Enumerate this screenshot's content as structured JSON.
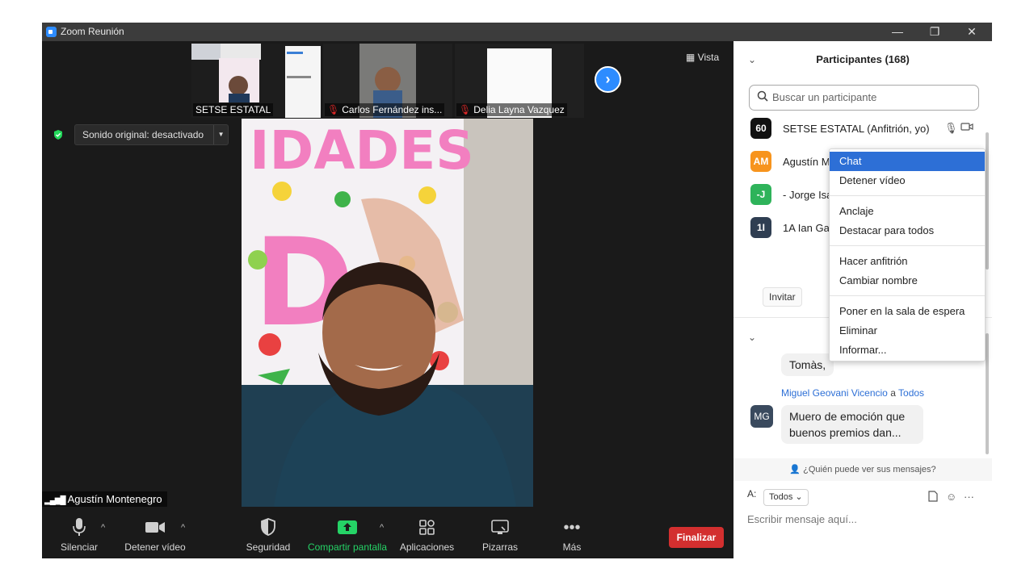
{
  "window": {
    "title": "Zoom Reunión",
    "minimize": "—",
    "restore": "❐",
    "close": "✕"
  },
  "gallery": {
    "thumbs": [
      {
        "label": "SETSE ESTATAL",
        "mic_off": false
      },
      {
        "label": "Carlos Fernández ins...",
        "mic_off": true
      },
      {
        "label": "Delia Layna Vazquez",
        "mic_off": true
      }
    ],
    "view_label": "Vista"
  },
  "meeting": {
    "sound_label": "Sonido original: desactivado",
    "speaker_name": "Agustín Montenegro"
  },
  "toolbar": {
    "mute": "Silenciar",
    "video": "Detener vídeo",
    "security": "Seguridad",
    "share": "Compartir pantalla",
    "apps": "Aplicaciones",
    "whiteboard": "Pizarras",
    "more": "Más",
    "end": "Finalizar"
  },
  "participants": {
    "title": "Participantes (168)",
    "search_placeholder": "Buscar un participante",
    "list": [
      {
        "initials": "60",
        "name": "SETSE ESTATAL (Anfitrión, yo)",
        "color": "#111111"
      },
      {
        "initials": "AM",
        "name": "Agustín M",
        "color": "#f7941d"
      },
      {
        "initials": "-J",
        "name": "- Jorge Isa",
        "color": "#2eb35a"
      },
      {
        "initials": "1I",
        "name": "1A Ian Gal",
        "color": "#2f3e52"
      }
    ],
    "invite": "Invitar"
  },
  "chat": {
    "partial_message": "Tomàs,",
    "sender": "Miguel Geovani Vicencio",
    "sender_to": "a",
    "recipient": "Todos",
    "sender_initials": "MG",
    "message": "Muero de emoción que buenos premios dan...",
    "who_can_see": "¿Quién puede ver sus mensajes?",
    "to_label": "A:",
    "to_value": "Todos",
    "input_placeholder": "Escribir mensaje aquí..."
  },
  "context_menu": {
    "items": [
      "Chat",
      "Detener vídeo",
      "Anclaje",
      "Destacar para todos",
      "Hacer anfitrión",
      "Cambiar nombre",
      "Poner en la sala de espera",
      "Eliminar",
      "Informar..."
    ]
  },
  "colors": {
    "accent": "#2d8cff",
    "end_button": "#d32f2f",
    "share_green": "#25d366",
    "menu_highlight": "#2d6fd6"
  }
}
